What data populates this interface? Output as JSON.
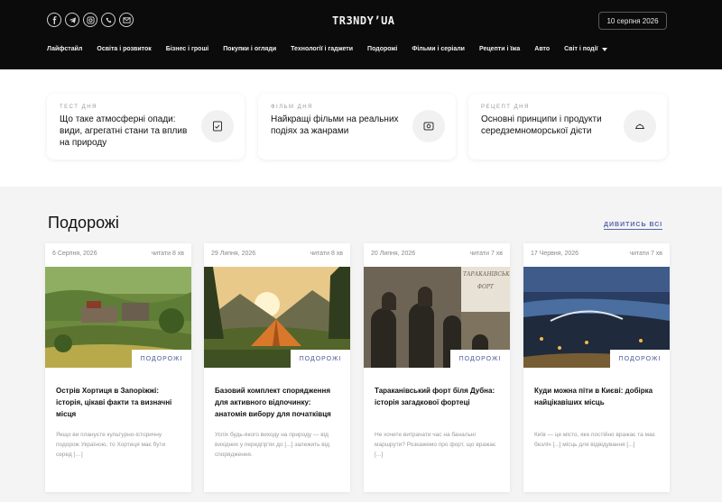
{
  "header": {
    "logo": "TR3NDY’UA",
    "date": "10 серпня 2026",
    "socials": [
      "facebook-icon",
      "telegram-icon",
      "instagram-icon",
      "viber-icon",
      "mail-icon"
    ],
    "nav": [
      "Лайфстайл",
      "Освіта і розвиток",
      "Бізнес і гроші",
      "Покупки і огляди",
      "Технології і гаджети",
      "Подорожі",
      "Фільми і серіали",
      "Рецепти і їжа",
      "Авто",
      "Світ і події"
    ]
  },
  "featured": [
    {
      "category": "ТЕСТ ДНЯ",
      "title": "Що таке атмосферні опади: види, агрегатні стани та вплив на природу",
      "icon": "test-icon"
    },
    {
      "category": "ФІЛЬМ ДНЯ",
      "title": "Найкращі фільми на реальних подіях за жанрами",
      "icon": "film-icon"
    },
    {
      "category": "РЕЦЕПТ ДНЯ",
      "title": "Основні принципи і продукти середземноморської дієти",
      "icon": "dish-icon"
    }
  ],
  "section": {
    "title": "Подорожі",
    "link": "ДИВИТИСЬ ВСІ"
  },
  "cards": [
    {
      "date": "6 Серпня, 2026",
      "read": "читати 8 хв",
      "badge": "ПОДОРОЖІ",
      "title": "Острів Хортиця в Запоріжжі: історія, цікаві факти та визначні місця",
      "excerpt": "Якщо ви плануєте культурно-історичну подорож Україною, то Хортиця має бути серед […]"
    },
    {
      "date": "29 Липня, 2026",
      "read": "читати 8 хв",
      "badge": "ПОДОРОЖІ",
      "title": "Базовий комплект спорядження для активного відпочинку: анатомія вибору для початківця",
      "excerpt": "Успіх будь-якого виходу на природу — від вихідних у передгір'ях до [...] залежить від спорядження."
    },
    {
      "date": "20 Липня, 2026",
      "read": "читати 7 хв",
      "badge": "ПОДОРОЖІ",
      "title": "Тараканівський форт біля Дубна: історія загадкової фортеці",
      "excerpt": "Не хочете витрачати час на банальні маршрути? Розкажемо про форт, що вражає [...]"
    },
    {
      "date": "17 Червня, 2026",
      "read": "читати 7 хв",
      "badge": "ПОДОРОЖІ",
      "title": "Куди можна піти в Києві: добірка найцікавіших місць",
      "excerpt": "Київ — це місто, яке постійно вражає та має безліч [...] місць для відвідування [...]"
    }
  ]
}
